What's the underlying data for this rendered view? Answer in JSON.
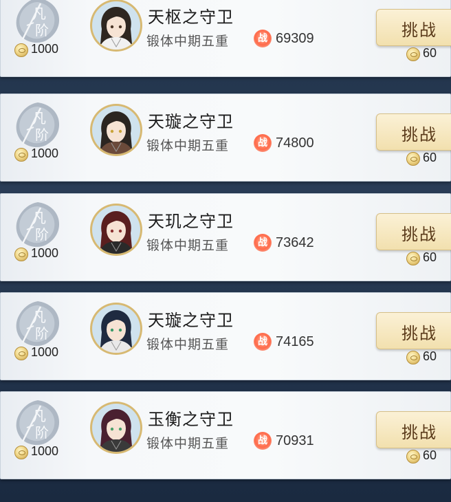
{
  "entries": [
    {
      "rank_label": "凡阶",
      "reward": "1000",
      "name": "天枢之守卫",
      "realm": "锻体中期五重",
      "power_icon": "战",
      "power": "69309",
      "button": "挑战",
      "cost": "60",
      "hair": "#2e2620",
      "robe": "#f1f1f1",
      "eyes": "#4a3526"
    },
    {
      "rank_label": "凡阶",
      "reward": "1000",
      "name": "天璇之守卫",
      "realm": "锻体中期五重",
      "power_icon": "战",
      "power": "74800",
      "button": "挑战",
      "cost": "60",
      "hair": "#2b2521",
      "robe": "#6b4a3a",
      "eyes": "#c8a43a"
    },
    {
      "rank_label": "凡阶",
      "reward": "1000",
      "name": "天玑之守卫",
      "realm": "锻体中期五重",
      "power_icon": "战",
      "power": "73642",
      "button": "挑战",
      "cost": "60",
      "hair": "#5a1f1f",
      "robe": "#2a2a2a",
      "eyes": "#8a3030"
    },
    {
      "rank_label": "凡阶",
      "reward": "1000",
      "name": "天璇之守卫",
      "realm": "锻体中期五重",
      "power_icon": "战",
      "power": "74165",
      "button": "挑战",
      "cost": "60",
      "hair": "#1f2a40",
      "robe": "#e9e9e9",
      "eyes": "#3a9a6a"
    },
    {
      "rank_label": "凡阶",
      "reward": "1000",
      "name": "玉衡之守卫",
      "realm": "锻体中期五重",
      "power_icon": "战",
      "power": "70931",
      "button": "挑战",
      "cost": "60",
      "hair": "#4a2030",
      "robe": "#3a3a3a",
      "eyes": "#4aa06a"
    }
  ]
}
